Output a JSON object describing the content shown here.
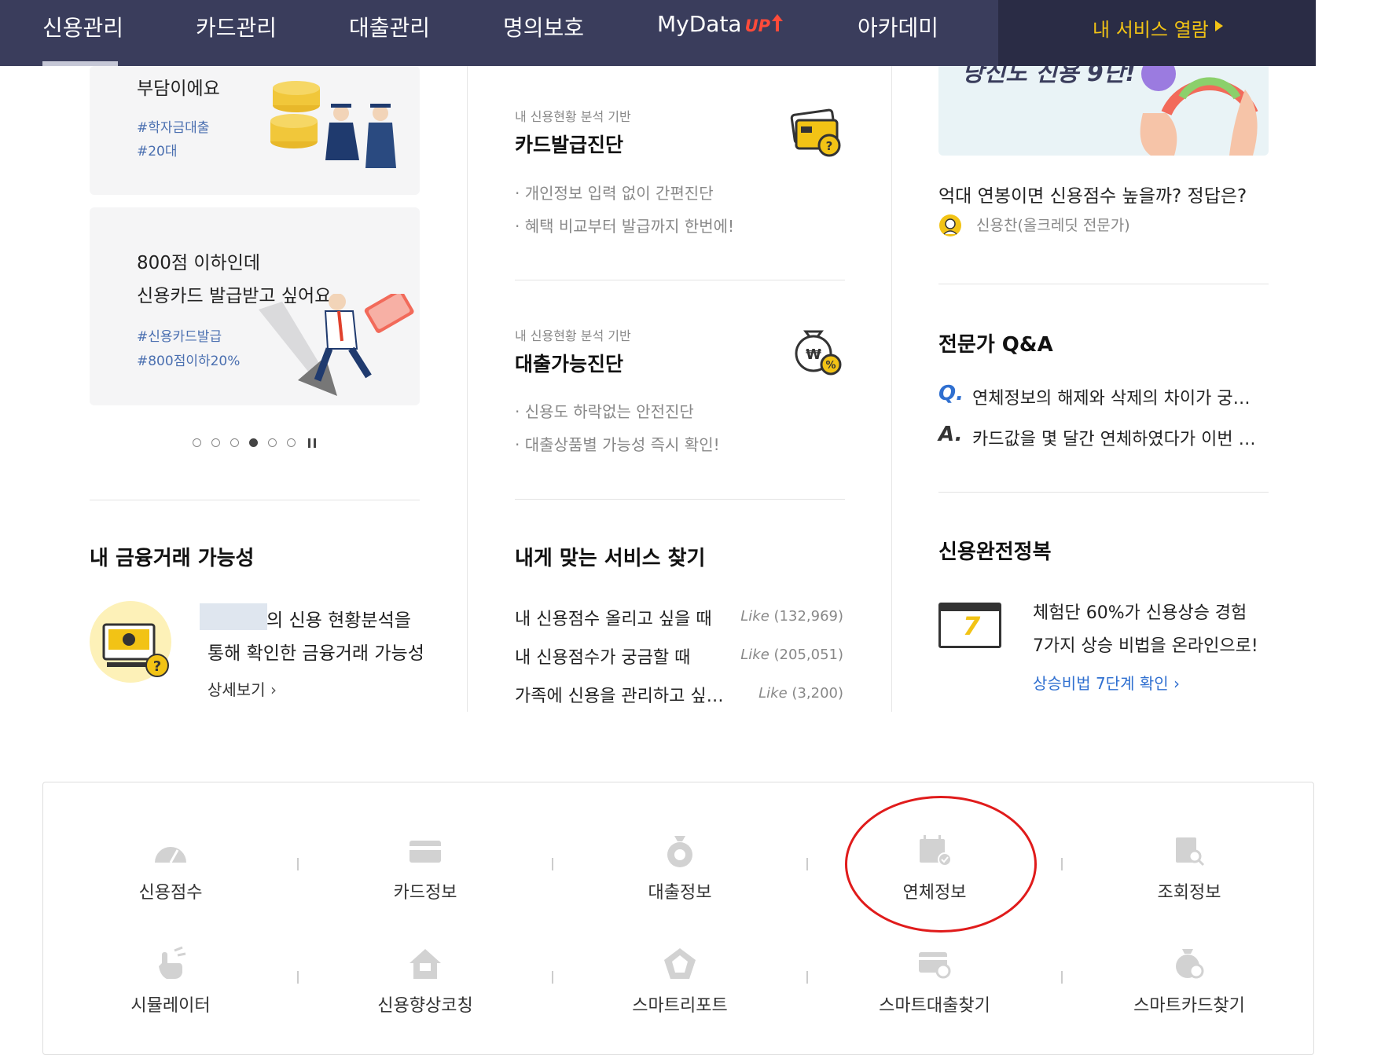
{
  "nav": {
    "items": [
      "신용관리",
      "카드관리",
      "대출관리",
      "명의보호",
      "MyData",
      "아카데미"
    ],
    "mydata_badge": "UP",
    "services_label": "내 서비스 열람"
  },
  "left": {
    "card1": {
      "line": "부담이에요",
      "tags": [
        "#학자금대출",
        "#20대"
      ]
    },
    "card2": {
      "line1": "800점 이하인데",
      "line2": "신용카드 발급받고 싶어요",
      "tags": [
        "#신용카드발급",
        "#800점이하20%"
      ]
    },
    "section_title": "내 금융거래 가능성",
    "desc1": "의 신용 현황분석을",
    "desc2": "통해 확인한 금융거래 가능성",
    "detail_link": "상세보기"
  },
  "middle": {
    "item1": {
      "small": "내 신용현황 분석 기반",
      "title": "카드발급진단",
      "bullets": [
        "개인정보 입력 없이 간편진단",
        "혜택 비교부터 발급까지 한번에!"
      ]
    },
    "item2": {
      "small": "내 신용현황 분석 기반",
      "title": "대출가능진단",
      "bullets": [
        "신용도 하락없는 안전진단",
        "대출상품별 가능성 즉시 확인!"
      ]
    },
    "section_title": "내게 맞는 서비스 찾기",
    "services": [
      {
        "label": "내 신용점수 올리고 싶을 때",
        "like_word": "Like",
        "like_count": "(132,969)"
      },
      {
        "label": "내 신용점수가 궁금할 때",
        "like_word": "Like",
        "like_count": "(205,051)"
      },
      {
        "label": "가족에 신용을 관리하고 싶…",
        "like_word": "Like",
        "like_count": "(3,200)"
      }
    ]
  },
  "right": {
    "banner_text": "당신도 신용 9단!",
    "article_title": "억대 연봉이면 신용점수 높을까? 정답은?",
    "author": "신용찬(올크레딧 전문가)",
    "qa_title": "전문가 Q&A",
    "q_mark": "Q.",
    "q_text": "연체정보의 해제와 삭제의 차이가 궁…",
    "a_mark": "A.",
    "a_text": "카드값을 몇 달간 연체하였다가 이번 …",
    "section_title": "신용완전정복",
    "calendar_num": "7",
    "line1": "체험단 60%가 신용상승 경험",
    "line2": "7가지 상승 비법을 온라인으로!",
    "link": "상승비법 7단계 확인"
  },
  "bottom_menu": {
    "row1": [
      "신용점수",
      "카드정보",
      "대출정보",
      "연체정보",
      "조회정보"
    ],
    "row2": [
      "시뮬레이터",
      "신용향상코칭",
      "스마트리포트",
      "스마트대출찾기",
      "스마트카드찾기"
    ],
    "row1_icons": [
      "gauge-icon",
      "card-icon",
      "money-bag-icon",
      "calendar-check-icon",
      "document-search-icon"
    ],
    "row2_icons": [
      "touch-icon",
      "house-up-icon",
      "pentagon-badge-icon",
      "card-search-icon",
      "coin-search-icon"
    ]
  },
  "carousel": {
    "total": 6,
    "active_index": 3
  },
  "colors": {
    "nav_bg": "#3a3d5c",
    "accent_yellow": "#f2c315",
    "link_blue": "#2f6fd0",
    "highlight_red": "#e01b1b"
  }
}
